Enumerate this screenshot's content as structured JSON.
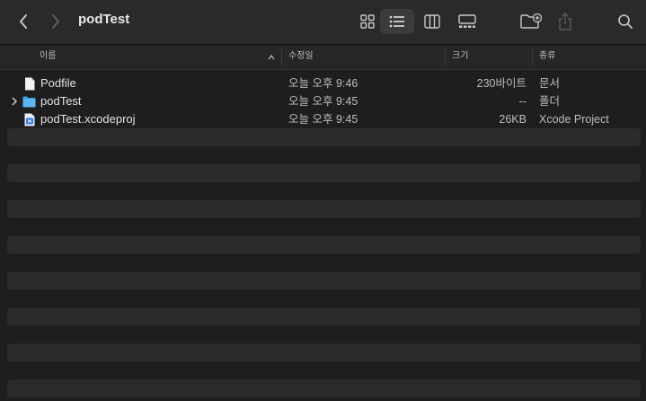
{
  "window": {
    "title": "podTest"
  },
  "toolbar": {
    "back_icon": "chevron-left-icon",
    "forward_icon": "chevron-right-icon",
    "views": [
      "icon-view-icon",
      "list-view-icon",
      "column-view-icon",
      "gallery-view-icon"
    ],
    "active_view": "list-view-icon",
    "actions": [
      "new-folder-icon",
      "share-icon",
      "search-icon"
    ]
  },
  "columns": {
    "name": "이름",
    "date": "수정일",
    "size": "크기",
    "kind": "종류"
  },
  "files": [
    {
      "name": "Podfile",
      "date": "오늘 오후 9:46",
      "size": "230바이트",
      "kind": "문서",
      "icon": "document-icon"
    },
    {
      "name": "podTest",
      "date": "오늘 오후 9:45",
      "size": "--",
      "kind": "폴더",
      "icon": "folder-icon"
    },
    {
      "name": "podTest.xcodeproj",
      "date": "오늘 오후 9:45",
      "size": "26KB",
      "kind": "Xcode Project",
      "icon": "xcodeproj-icon"
    }
  ],
  "colors": {
    "background": "#1e1e1e",
    "toolbar": "#2a2a2a",
    "stripe": "#2b2b2b",
    "folder_blue": "#3aa0e8"
  }
}
